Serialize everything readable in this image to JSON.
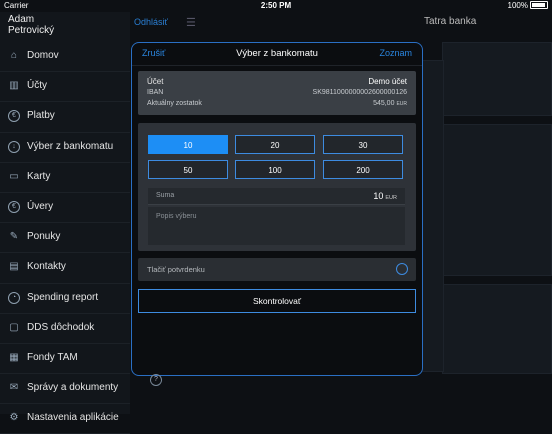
{
  "status_bar": {
    "carrier": "Carrier",
    "time": "2:50 PM",
    "battery": "100%"
  },
  "user": {
    "first_name": "Adam",
    "last_name": "Petrovický"
  },
  "nav": [
    {
      "label": "Domov",
      "icon": "home-icon"
    },
    {
      "label": "Účty",
      "icon": "bar-chart-icon"
    },
    {
      "label": "Platby",
      "icon": "payment-icon"
    },
    {
      "label": "Výber z bankomatu",
      "icon": "atm-icon"
    },
    {
      "label": "Karty",
      "icon": "card-icon"
    },
    {
      "label": "Úvery",
      "icon": "loan-icon"
    },
    {
      "label": "Ponuky",
      "icon": "offer-icon"
    },
    {
      "label": "Kontakty",
      "icon": "contacts-icon"
    },
    {
      "label": "Spending report",
      "icon": "report-icon"
    },
    {
      "label": "DDS dôchodok",
      "icon": "pension-icon"
    },
    {
      "label": "Fondy TAM",
      "icon": "funds-icon"
    },
    {
      "label": "Správy a dokumenty",
      "icon": "documents-icon"
    },
    {
      "label": "Nastavenia aplikácie",
      "icon": "settings-icon"
    }
  ],
  "background": {
    "logout": "Odhlásiť",
    "bank_title": "Tatra banka"
  },
  "modal": {
    "cancel": "Zrušiť",
    "title": "Výber z bankomatu",
    "list": "Zoznam",
    "account": {
      "label": "Účet",
      "value": "Demo účet",
      "iban_label": "IBAN",
      "iban_value": "SK9811000000002600000126",
      "balance_label": "Aktuálny zostatok",
      "balance_value": "545,00",
      "balance_currency": "EUR"
    },
    "amounts": [
      "10",
      "20",
      "30",
      "50",
      "100",
      "200"
    ],
    "selected_amount": "10",
    "sum_label": "Suma",
    "sum_value": "10",
    "sum_currency": "EUR",
    "description_placeholder": "Popis výberu",
    "print_receipt_label": "Tlačiť potvrdenku",
    "submit_label": "Skontrolovať"
  },
  "colors": {
    "accent": "#1d8ef5",
    "link": "#2a86e0"
  }
}
